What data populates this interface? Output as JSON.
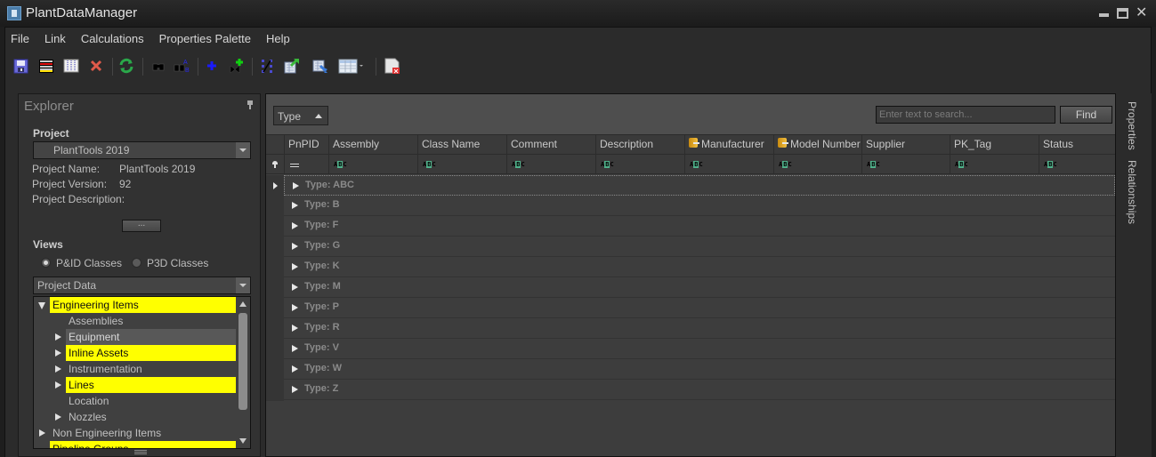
{
  "window": {
    "title": "PlantDataManager",
    "controls": [
      "minimize",
      "maximize",
      "close"
    ]
  },
  "menu": [
    {
      "label": "File"
    },
    {
      "label": "Link"
    },
    {
      "label": "Calculations"
    },
    {
      "label": "Properties Palette"
    },
    {
      "label": "Help"
    }
  ],
  "toolbar": {
    "buttons": [
      {
        "name": "save-icon"
      },
      {
        "name": "row-colors-icon"
      },
      {
        "name": "columns-icon"
      },
      {
        "name": "delete-icon"
      },
      {
        "name": "refresh-icon"
      },
      {
        "name": "find-icon"
      },
      {
        "name": "find-replace-icon"
      },
      {
        "name": "add-icon"
      },
      {
        "name": "add-linked-icon"
      },
      {
        "name": "link-icon"
      },
      {
        "name": "export-icon"
      },
      {
        "name": "import-icon"
      },
      {
        "name": "view-options-icon"
      },
      {
        "name": "close-document-icon"
      }
    ]
  },
  "explorer": {
    "title": "Explorer",
    "project_label": "Project",
    "project_selected": "PlantTools 2019",
    "project_name_label": "Project Name:",
    "project_name_value": "PlantTools 2019",
    "project_version_label": "Project Version:",
    "project_version_value": "92",
    "project_description_label": "Project Description:",
    "project_description_value": "",
    "ellipsis_button": "...",
    "views_label": "Views",
    "view_options": [
      {
        "label": "P&ID Classes",
        "checked": true
      },
      {
        "label": "P3D Classes",
        "checked": false
      }
    ],
    "data_selected": "Project Data",
    "tree": [
      {
        "label": "Engineering Items",
        "level": 0,
        "expander": "expanded",
        "highlight": "yellow"
      },
      {
        "label": "Assemblies",
        "level": 1,
        "expander": "none",
        "highlight": "none"
      },
      {
        "label": "Equipment",
        "level": 1,
        "expander": "collapsed",
        "highlight": "selected"
      },
      {
        "label": "Inline Assets",
        "level": 1,
        "expander": "collapsed",
        "highlight": "yellow"
      },
      {
        "label": "Instrumentation",
        "level": 1,
        "expander": "collapsed",
        "highlight": "none"
      },
      {
        "label": "Lines",
        "level": 1,
        "expander": "collapsed",
        "highlight": "yellow"
      },
      {
        "label": "Location",
        "level": 1,
        "expander": "none",
        "highlight": "none"
      },
      {
        "label": "Nozzles",
        "level": 1,
        "expander": "collapsed",
        "highlight": "none"
      },
      {
        "label": "Non Engineering Items",
        "level": 0,
        "expander": "collapsed",
        "highlight": "none"
      },
      {
        "label": "Pipeline Groups",
        "level": 0,
        "expander": "none",
        "highlight": "yellow"
      }
    ]
  },
  "grid": {
    "group_by_chip": "Type",
    "search_placeholder": "Enter text to search...",
    "find_label": "Find",
    "columns": [
      {
        "label": "PnPID",
        "icon": "",
        "filter": "equals"
      },
      {
        "label": "Assembly",
        "icon": "",
        "filter": "text"
      },
      {
        "label": "Class Name",
        "icon": "",
        "filter": "text"
      },
      {
        "label": "Comment",
        "icon": "",
        "filter": "text"
      },
      {
        "label": "Description",
        "icon": "",
        "filter": "text"
      },
      {
        "label": "Manufacturer",
        "icon": "linked-db-icon",
        "filter": "text"
      },
      {
        "label": "Model Number",
        "icon": "linked-db-icon",
        "filter": "text"
      },
      {
        "label": "Supplier",
        "icon": "",
        "filter": "text"
      },
      {
        "label": "PK_Tag",
        "icon": "",
        "filter": "text"
      },
      {
        "label": "Status",
        "icon": "",
        "filter": "text"
      }
    ],
    "filter_text_glyph": "ABC",
    "groups": [
      "Type: ABC",
      "Type: B",
      "Type: F",
      "Type: G",
      "Type: K",
      "Type: M",
      "Type: P",
      "Type: R",
      "Type: V",
      "Type: W",
      "Type: Z"
    ]
  },
  "side_tabs": [
    "Properties",
    "Relationships"
  ]
}
